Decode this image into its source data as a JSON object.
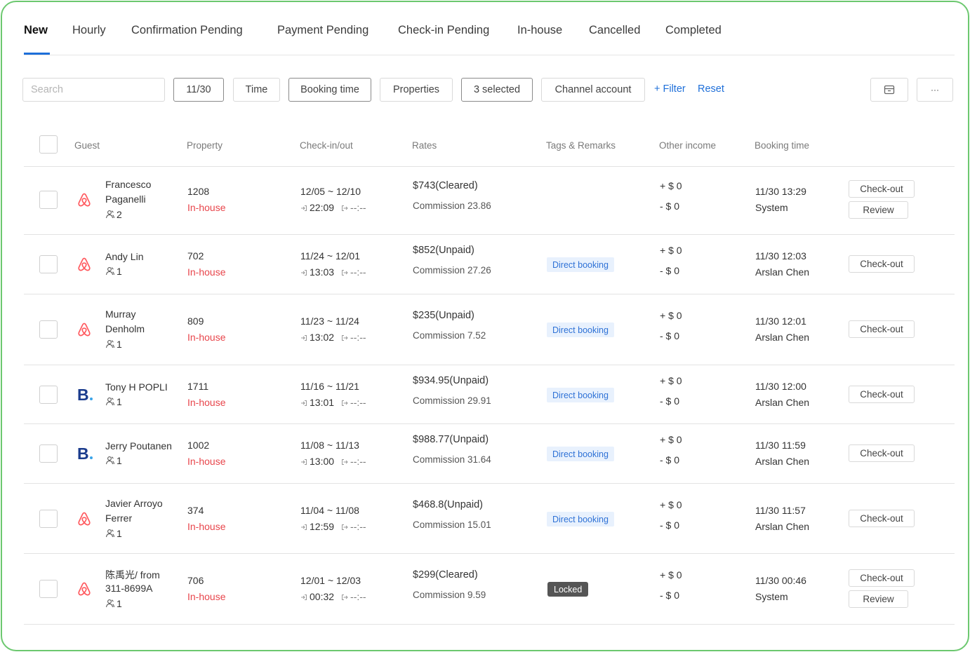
{
  "tabs": [
    "New",
    "Hourly",
    "Confirmation Pending",
    "Payment Pending",
    "Check-in Pending",
    "In-house",
    "Cancelled",
    "Completed"
  ],
  "filters": {
    "search_placeholder": "Search",
    "date": "11/30",
    "time": "Time",
    "booking_time": "Booking time",
    "properties": "Properties",
    "selected": "3 selected",
    "channel_account": "Channel account",
    "add_filter": "+ Filter",
    "reset": "Reset",
    "more": "···"
  },
  "columns": {
    "guest": "Guest",
    "property": "Property",
    "check": "Check-in/out",
    "rates": "Rates",
    "tags": "Tags & Remarks",
    "other": "Other income",
    "booking_time": "Booking time"
  },
  "rows": [
    {
      "channel": "airbnb-icon",
      "guest_lines": [
        "Francesco",
        "Paganelli"
      ],
      "guests": "2",
      "property": "1208",
      "status": "In-house",
      "dates": "12/05 ~ 12/10",
      "checkin_time": "22:09",
      "checkout_time": "--:--",
      "rate": "$743(Cleared)",
      "commission": "Commission 23.86",
      "tag": "",
      "plus": "+ $ 0",
      "minus": "- $ 0",
      "booked_at": "11/30 13:29",
      "booked_by": "System",
      "actions": [
        "Check-out",
        "Review"
      ]
    },
    {
      "channel": "airbnb-icon",
      "guest_lines": [
        "Andy Lin"
      ],
      "guests": "1",
      "property": "702",
      "status": "In-house",
      "dates": "11/24 ~ 12/01",
      "checkin_time": "13:03",
      "checkout_time": "--:--",
      "rate": "$852(Unpaid)",
      "commission": "Commission 27.26",
      "tag": "Direct booking",
      "plus": "+ $ 0",
      "minus": "- $ 0",
      "booked_at": "11/30 12:03",
      "booked_by": "Arslan Chen",
      "actions": [
        "Check-out"
      ]
    },
    {
      "channel": "airbnb-icon",
      "guest_lines": [
        "Murray",
        "Denholm"
      ],
      "guests": "1",
      "property": "809",
      "status": "In-house",
      "dates": "11/23 ~ 11/24",
      "checkin_time": "13:02",
      "checkout_time": "--:--",
      "rate": "$235(Unpaid)",
      "commission": "Commission 7.52",
      "tag": "Direct booking",
      "plus": "+ $ 0",
      "minus": "- $ 0",
      "booked_at": "11/30 12:01",
      "booked_by": "Arslan Chen",
      "actions": [
        "Check-out"
      ]
    },
    {
      "channel": "booking-icon",
      "guest_lines": [
        "Tony H POPLI"
      ],
      "guests": "1",
      "property": "1711",
      "status": "In-house",
      "dates": "11/16 ~ 11/21",
      "checkin_time": "13:01",
      "checkout_time": "--:--",
      "rate": "$934.95(Unpaid)",
      "commission": "Commission 29.91",
      "tag": "Direct booking",
      "plus": "+ $ 0",
      "minus": "- $ 0",
      "booked_at": "11/30 12:00",
      "booked_by": "Arslan Chen",
      "actions": [
        "Check-out"
      ]
    },
    {
      "channel": "booking-icon",
      "guest_lines": [
        "Jerry Poutanen"
      ],
      "guests": "1",
      "property": "1002",
      "status": "In-house",
      "dates": "11/08 ~ 11/13",
      "checkin_time": "13:00",
      "checkout_time": "--:--",
      "rate": "$988.77(Unpaid)",
      "commission": "Commission 31.64",
      "tag": "Direct booking",
      "plus": "+ $ 0",
      "minus": "- $ 0",
      "booked_at": "11/30 11:59",
      "booked_by": "Arslan Chen",
      "actions": [
        "Check-out"
      ]
    },
    {
      "channel": "airbnb-icon",
      "guest_lines": [
        "Javier Arroyo",
        "Ferrer"
      ],
      "guests": "1",
      "property": "374",
      "status": "In-house",
      "dates": "11/04 ~ 11/08",
      "checkin_time": "12:59",
      "checkout_time": "--:--",
      "rate": "$468.8(Unpaid)",
      "commission": "Commission 15.01",
      "tag": "Direct booking",
      "plus": "+ $ 0",
      "minus": "- $ 0",
      "booked_at": "11/30 11:57",
      "booked_by": "Arslan Chen",
      "actions": [
        "Check-out"
      ]
    },
    {
      "channel": "airbnb-icon",
      "guest_lines": [
        "陈禹光/ from",
        "311-8699A"
      ],
      "guests": "1",
      "property": "706",
      "status": "In-house",
      "dates": "12/01 ~ 12/03",
      "checkin_time": "00:32",
      "checkout_time": "--:--",
      "rate": "$299(Cleared)",
      "commission": "Commission 9.59",
      "tag": "Locked",
      "plus": "+ $ 0",
      "minus": "- $ 0",
      "booked_at": "11/30 00:46",
      "booked_by": "System",
      "actions": [
        "Check-out",
        "Review"
      ]
    }
  ],
  "colors": {
    "accent": "#1e6fd9",
    "status_red": "#e8454b",
    "airbnb": "#ff5a5f",
    "booking": "#1b3c8d",
    "frame_green": "#6cc86f"
  }
}
